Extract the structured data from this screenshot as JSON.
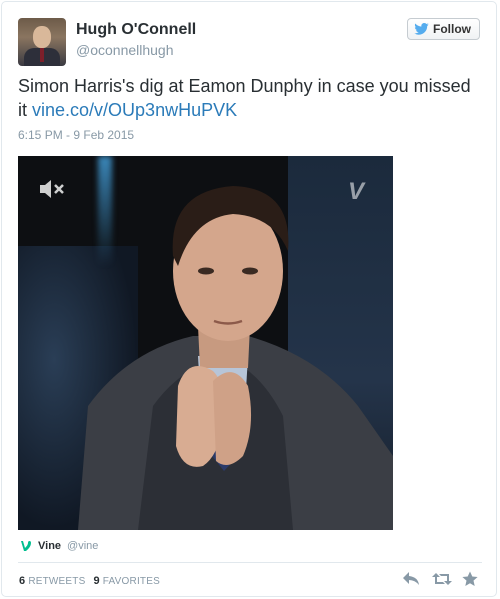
{
  "user": {
    "display_name": "Hugh O'Connell",
    "screen_name": "@oconnellhugh"
  },
  "follow_button": {
    "label": "Follow",
    "icon": "twitter-bird-icon"
  },
  "tweet": {
    "text": "Simon Harris's dig at Eamon Dunphy in case you missed it ",
    "link": "vine.co/v/OUp3nwHuPVK",
    "timestamp": "6:15 PM - 9 Feb 2015"
  },
  "media": {
    "mute_icon": "speaker-muted-icon",
    "watermark_icon": "vine-logo-icon",
    "watermark": "V"
  },
  "source": {
    "name": "Vine",
    "handle": "@vine"
  },
  "stats": {
    "retweets_count": "6",
    "retweets_label": "RETWEETS",
    "favorites_count": "9",
    "favorites_label": "FAVORITES"
  },
  "actions": [
    "reply-icon",
    "retweet-icon",
    "favorite-icon"
  ],
  "colors": {
    "link": "#2b7bb9",
    "secondary_text": "#8899a6",
    "primary_text": "#292f33",
    "twitter_blue": "#55acee",
    "vine_green": "#00bf8f"
  }
}
